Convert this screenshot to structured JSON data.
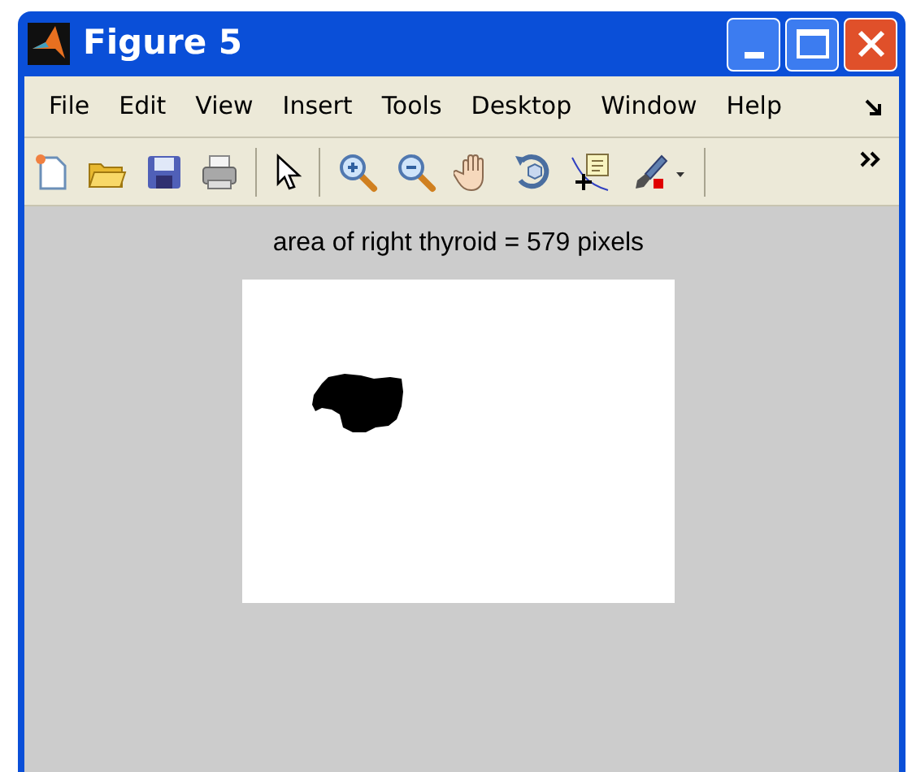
{
  "window": {
    "title": "Figure 5"
  },
  "menu": [
    "File",
    "Edit",
    "View",
    "Insert",
    "Tools",
    "Desktop",
    "Window",
    "Help"
  ],
  "toolbar": [
    {
      "kind": "new"
    },
    {
      "kind": "open"
    },
    {
      "kind": "save"
    },
    {
      "kind": "print"
    },
    {
      "kind": "sep"
    },
    {
      "kind": "pointer"
    },
    {
      "kind": "sep"
    },
    {
      "kind": "zoomin"
    },
    {
      "kind": "zoomout"
    },
    {
      "kind": "pan"
    },
    {
      "kind": "rotate"
    },
    {
      "kind": "datacursor"
    },
    {
      "kind": "brush"
    },
    {
      "kind": "sep"
    }
  ],
  "axes": {
    "title": "area of right thyroid = 579 pixels"
  }
}
